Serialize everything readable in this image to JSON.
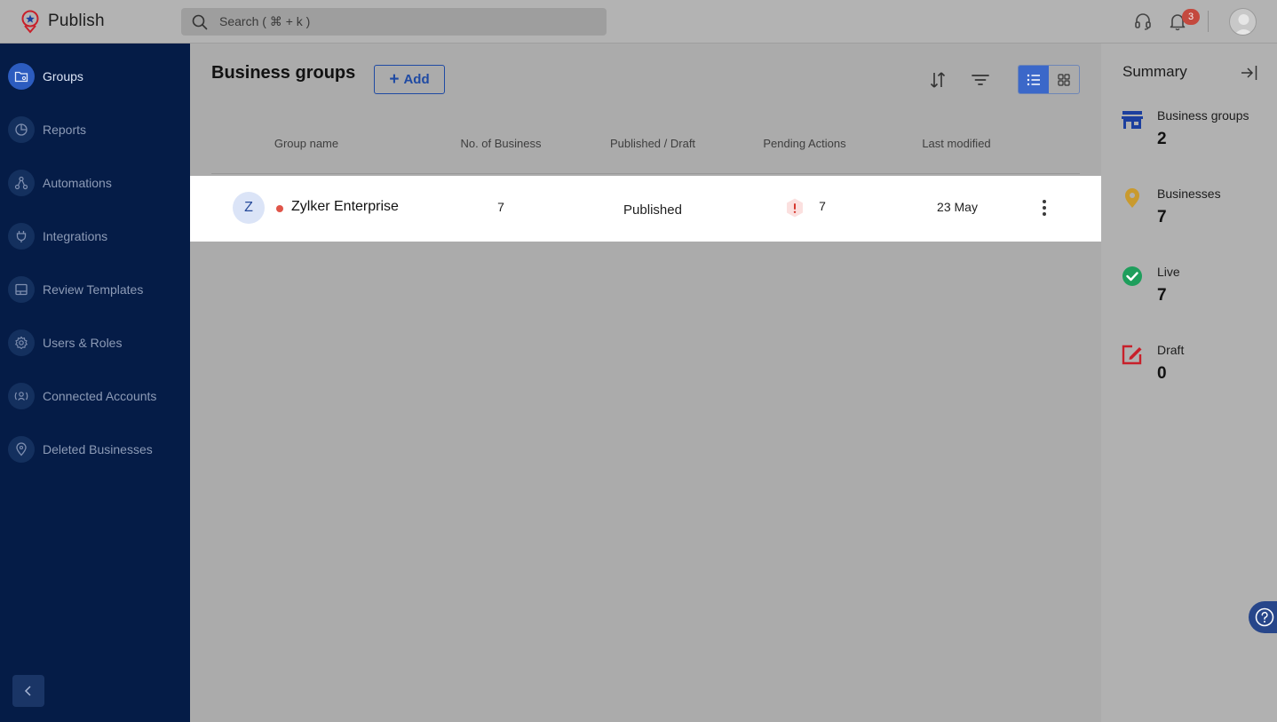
{
  "app": {
    "name": "Publish",
    "search_placeholder": "Search ( ⌘ + k )",
    "notification_count": "3",
    "colors": {
      "sidebar_bg": "#051c47",
      "accent": "#2c5cbf",
      "badge": "#c4493e"
    }
  },
  "sidebar": {
    "items": [
      {
        "label": "Groups",
        "icon": "folder-pin-icon",
        "active": true
      },
      {
        "label": "Reports",
        "icon": "pie-chart-icon",
        "active": false
      },
      {
        "label": "Automations",
        "icon": "flow-icon",
        "active": false
      },
      {
        "label": "Integrations",
        "icon": "plug-icon",
        "active": false
      },
      {
        "label": "Review Templates",
        "icon": "template-icon",
        "active": false
      },
      {
        "label": "Users & Roles",
        "icon": "gear-icon",
        "active": false
      },
      {
        "label": "Connected Accounts",
        "icon": "connected-user-icon",
        "active": false
      },
      {
        "label": "Deleted Businesses",
        "icon": "location-pin-icon",
        "active": false
      }
    ]
  },
  "main": {
    "title": "Business groups",
    "add_label": "Add",
    "columns": [
      "Group name",
      "No. of Business",
      "Published / Draft",
      "Pending Actions",
      "Last modified"
    ],
    "rows": [
      {
        "initial": "Z",
        "name": "Zylker Enterprise",
        "businesses": "7",
        "status": "Published",
        "pending": "7",
        "last_modified": "23 May"
      }
    ]
  },
  "summary": {
    "title": "Summary",
    "items": [
      {
        "label": "Business groups",
        "value": "2",
        "icon": "store-icon",
        "color": "#1c3f9e"
      },
      {
        "label": "Businesses",
        "value": "7",
        "icon": "map-pin-icon",
        "color": "#c99a2e"
      },
      {
        "label": "Live",
        "value": "7",
        "icon": "check-circle-icon",
        "color": "#1e9e5c"
      },
      {
        "label": "Draft",
        "value": "0",
        "icon": "edit-icon",
        "color": "#c8202a"
      }
    ]
  }
}
